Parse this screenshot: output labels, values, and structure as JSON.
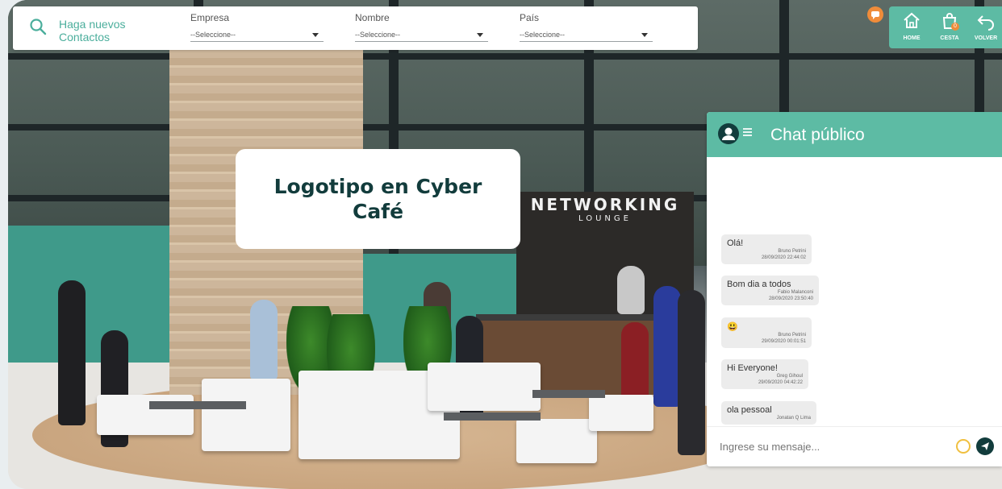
{
  "search": {
    "label_line1": "Haga nuevos",
    "label_line2": "Contactos"
  },
  "filters": [
    {
      "label": "Empresa",
      "value": "--Seleccione--"
    },
    {
      "label": "Nombre",
      "value": "--Seleccione--"
    },
    {
      "label": "País",
      "value": "--Seleccione--"
    }
  ],
  "nav": {
    "home": "HOME",
    "cart": "CESTA",
    "cart_count": "0",
    "back": "VOLVER"
  },
  "logo_placeholder": "Logotipo en Cyber Café",
  "scene": {
    "sign_title": "NETWORKING",
    "sign_sub": "LOUNGE"
  },
  "chat": {
    "title": "Chat público",
    "input_placeholder": "Ingrese su mensaje...",
    "messages": [
      {
        "text": "Olá!",
        "author": "Bruno Petrini",
        "time": "28/09/2020 22:44:02"
      },
      {
        "text": "Bom dia a todos",
        "author": "Fabio Malanconi",
        "time": "28/09/2020 23:50:40"
      },
      {
        "text": "😃",
        "author": "Bruno Petrini",
        "time": "29/09/2020 00:01:51"
      },
      {
        "text": "Hi Everyone!",
        "author": "Greg Gihoul",
        "time": "29/09/2020 04:42:22"
      },
      {
        "text": "ola pessoal",
        "author": "Jonatan Q Lima",
        "time": ""
      }
    ]
  },
  "colors": {
    "accent": "#5dbba4",
    "dark": "#123c3c",
    "notif": "#f08c3a"
  }
}
